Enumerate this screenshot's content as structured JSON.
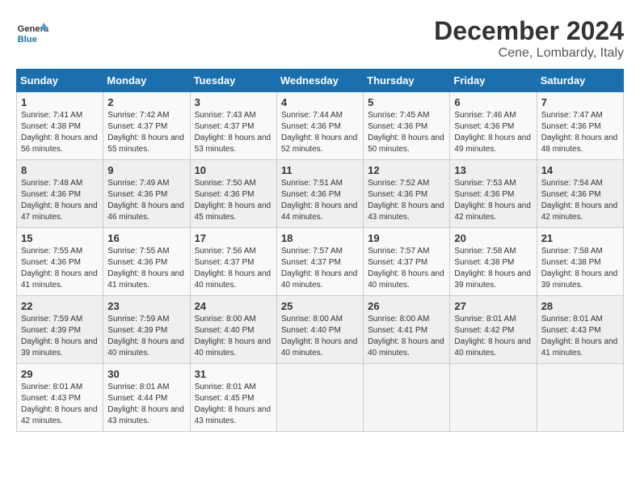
{
  "header": {
    "logo_line1": "General",
    "logo_line2": "Blue",
    "month": "December 2024",
    "location": "Cene, Lombardy, Italy"
  },
  "weekdays": [
    "Sunday",
    "Monday",
    "Tuesday",
    "Wednesday",
    "Thursday",
    "Friday",
    "Saturday"
  ],
  "weeks": [
    [
      {
        "day": "1",
        "sunrise": "7:41 AM",
        "sunset": "4:38 PM",
        "daylight": "8 hours and 56 minutes."
      },
      {
        "day": "2",
        "sunrise": "7:42 AM",
        "sunset": "4:37 PM",
        "daylight": "8 hours and 55 minutes."
      },
      {
        "day": "3",
        "sunrise": "7:43 AM",
        "sunset": "4:37 PM",
        "daylight": "8 hours and 53 minutes."
      },
      {
        "day": "4",
        "sunrise": "7:44 AM",
        "sunset": "4:36 PM",
        "daylight": "8 hours and 52 minutes."
      },
      {
        "day": "5",
        "sunrise": "7:45 AM",
        "sunset": "4:36 PM",
        "daylight": "8 hours and 50 minutes."
      },
      {
        "day": "6",
        "sunrise": "7:46 AM",
        "sunset": "4:36 PM",
        "daylight": "8 hours and 49 minutes."
      },
      {
        "day": "7",
        "sunrise": "7:47 AM",
        "sunset": "4:36 PM",
        "daylight": "8 hours and 48 minutes."
      }
    ],
    [
      {
        "day": "8",
        "sunrise": "7:48 AM",
        "sunset": "4:36 PM",
        "daylight": "8 hours and 47 minutes."
      },
      {
        "day": "9",
        "sunrise": "7:49 AM",
        "sunset": "4:36 PM",
        "daylight": "8 hours and 46 minutes."
      },
      {
        "day": "10",
        "sunrise": "7:50 AM",
        "sunset": "4:36 PM",
        "daylight": "8 hours and 45 minutes."
      },
      {
        "day": "11",
        "sunrise": "7:51 AM",
        "sunset": "4:36 PM",
        "daylight": "8 hours and 44 minutes."
      },
      {
        "day": "12",
        "sunrise": "7:52 AM",
        "sunset": "4:36 PM",
        "daylight": "8 hours and 43 minutes."
      },
      {
        "day": "13",
        "sunrise": "7:53 AM",
        "sunset": "4:36 PM",
        "daylight": "8 hours and 42 minutes."
      },
      {
        "day": "14",
        "sunrise": "7:54 AM",
        "sunset": "4:36 PM",
        "daylight": "8 hours and 42 minutes."
      }
    ],
    [
      {
        "day": "15",
        "sunrise": "7:55 AM",
        "sunset": "4:36 PM",
        "daylight": "8 hours and 41 minutes."
      },
      {
        "day": "16",
        "sunrise": "7:55 AM",
        "sunset": "4:36 PM",
        "daylight": "8 hours and 41 minutes."
      },
      {
        "day": "17",
        "sunrise": "7:56 AM",
        "sunset": "4:37 PM",
        "daylight": "8 hours and 40 minutes."
      },
      {
        "day": "18",
        "sunrise": "7:57 AM",
        "sunset": "4:37 PM",
        "daylight": "8 hours and 40 minutes."
      },
      {
        "day": "19",
        "sunrise": "7:57 AM",
        "sunset": "4:37 PM",
        "daylight": "8 hours and 40 minutes."
      },
      {
        "day": "20",
        "sunrise": "7:58 AM",
        "sunset": "4:38 PM",
        "daylight": "8 hours and 39 minutes."
      },
      {
        "day": "21",
        "sunrise": "7:58 AM",
        "sunset": "4:38 PM",
        "daylight": "8 hours and 39 minutes."
      }
    ],
    [
      {
        "day": "22",
        "sunrise": "7:59 AM",
        "sunset": "4:39 PM",
        "daylight": "8 hours and 39 minutes."
      },
      {
        "day": "23",
        "sunrise": "7:59 AM",
        "sunset": "4:39 PM",
        "daylight": "8 hours and 40 minutes."
      },
      {
        "day": "24",
        "sunrise": "8:00 AM",
        "sunset": "4:40 PM",
        "daylight": "8 hours and 40 minutes."
      },
      {
        "day": "25",
        "sunrise": "8:00 AM",
        "sunset": "4:40 PM",
        "daylight": "8 hours and 40 minutes."
      },
      {
        "day": "26",
        "sunrise": "8:00 AM",
        "sunset": "4:41 PM",
        "daylight": "8 hours and 40 minutes."
      },
      {
        "day": "27",
        "sunrise": "8:01 AM",
        "sunset": "4:42 PM",
        "daylight": "8 hours and 40 minutes."
      },
      {
        "day": "28",
        "sunrise": "8:01 AM",
        "sunset": "4:43 PM",
        "daylight": "8 hours and 41 minutes."
      }
    ],
    [
      {
        "day": "29",
        "sunrise": "8:01 AM",
        "sunset": "4:43 PM",
        "daylight": "8 hours and 42 minutes."
      },
      {
        "day": "30",
        "sunrise": "8:01 AM",
        "sunset": "4:44 PM",
        "daylight": "8 hours and 43 minutes."
      },
      {
        "day": "31",
        "sunrise": "8:01 AM",
        "sunset": "4:45 PM",
        "daylight": "8 hours and 43 minutes."
      },
      null,
      null,
      null,
      null
    ]
  ]
}
